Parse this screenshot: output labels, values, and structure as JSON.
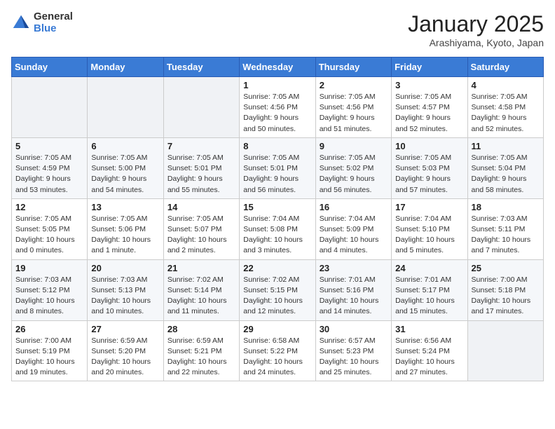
{
  "header": {
    "logo_general": "General",
    "logo_blue": "Blue",
    "title": "January 2025",
    "subtitle": "Arashiyama, Kyoto, Japan"
  },
  "weekdays": [
    "Sunday",
    "Monday",
    "Tuesday",
    "Wednesday",
    "Thursday",
    "Friday",
    "Saturday"
  ],
  "weeks": [
    [
      {
        "day": "",
        "empty": true
      },
      {
        "day": "",
        "empty": true
      },
      {
        "day": "",
        "empty": true
      },
      {
        "day": "1",
        "sunrise": "7:05 AM",
        "sunset": "4:56 PM",
        "daylight": "9 hours and 50 minutes."
      },
      {
        "day": "2",
        "sunrise": "7:05 AM",
        "sunset": "4:56 PM",
        "daylight": "9 hours and 51 minutes."
      },
      {
        "day": "3",
        "sunrise": "7:05 AM",
        "sunset": "4:57 PM",
        "daylight": "9 hours and 52 minutes."
      },
      {
        "day": "4",
        "sunrise": "7:05 AM",
        "sunset": "4:58 PM",
        "daylight": "9 hours and 52 minutes."
      }
    ],
    [
      {
        "day": "5",
        "sunrise": "7:05 AM",
        "sunset": "4:59 PM",
        "daylight": "9 hours and 53 minutes."
      },
      {
        "day": "6",
        "sunrise": "7:05 AM",
        "sunset": "5:00 PM",
        "daylight": "9 hours and 54 minutes."
      },
      {
        "day": "7",
        "sunrise": "7:05 AM",
        "sunset": "5:01 PM",
        "daylight": "9 hours and 55 minutes."
      },
      {
        "day": "8",
        "sunrise": "7:05 AM",
        "sunset": "5:01 PM",
        "daylight": "9 hours and 56 minutes."
      },
      {
        "day": "9",
        "sunrise": "7:05 AM",
        "sunset": "5:02 PM",
        "daylight": "9 hours and 56 minutes."
      },
      {
        "day": "10",
        "sunrise": "7:05 AM",
        "sunset": "5:03 PM",
        "daylight": "9 hours and 57 minutes."
      },
      {
        "day": "11",
        "sunrise": "7:05 AM",
        "sunset": "5:04 PM",
        "daylight": "9 hours and 58 minutes."
      }
    ],
    [
      {
        "day": "12",
        "sunrise": "7:05 AM",
        "sunset": "5:05 PM",
        "daylight": "10 hours and 0 minutes."
      },
      {
        "day": "13",
        "sunrise": "7:05 AM",
        "sunset": "5:06 PM",
        "daylight": "10 hours and 1 minute."
      },
      {
        "day": "14",
        "sunrise": "7:05 AM",
        "sunset": "5:07 PM",
        "daylight": "10 hours and 2 minutes."
      },
      {
        "day": "15",
        "sunrise": "7:04 AM",
        "sunset": "5:08 PM",
        "daylight": "10 hours and 3 minutes."
      },
      {
        "day": "16",
        "sunrise": "7:04 AM",
        "sunset": "5:09 PM",
        "daylight": "10 hours and 4 minutes."
      },
      {
        "day": "17",
        "sunrise": "7:04 AM",
        "sunset": "5:10 PM",
        "daylight": "10 hours and 5 minutes."
      },
      {
        "day": "18",
        "sunrise": "7:03 AM",
        "sunset": "5:11 PM",
        "daylight": "10 hours and 7 minutes."
      }
    ],
    [
      {
        "day": "19",
        "sunrise": "7:03 AM",
        "sunset": "5:12 PM",
        "daylight": "10 hours and 8 minutes."
      },
      {
        "day": "20",
        "sunrise": "7:03 AM",
        "sunset": "5:13 PM",
        "daylight": "10 hours and 10 minutes."
      },
      {
        "day": "21",
        "sunrise": "7:02 AM",
        "sunset": "5:14 PM",
        "daylight": "10 hours and 11 minutes."
      },
      {
        "day": "22",
        "sunrise": "7:02 AM",
        "sunset": "5:15 PM",
        "daylight": "10 hours and 12 minutes."
      },
      {
        "day": "23",
        "sunrise": "7:01 AM",
        "sunset": "5:16 PM",
        "daylight": "10 hours and 14 minutes."
      },
      {
        "day": "24",
        "sunrise": "7:01 AM",
        "sunset": "5:17 PM",
        "daylight": "10 hours and 15 minutes."
      },
      {
        "day": "25",
        "sunrise": "7:00 AM",
        "sunset": "5:18 PM",
        "daylight": "10 hours and 17 minutes."
      }
    ],
    [
      {
        "day": "26",
        "sunrise": "7:00 AM",
        "sunset": "5:19 PM",
        "daylight": "10 hours and 19 minutes."
      },
      {
        "day": "27",
        "sunrise": "6:59 AM",
        "sunset": "5:20 PM",
        "daylight": "10 hours and 20 minutes."
      },
      {
        "day": "28",
        "sunrise": "6:59 AM",
        "sunset": "5:21 PM",
        "daylight": "10 hours and 22 minutes."
      },
      {
        "day": "29",
        "sunrise": "6:58 AM",
        "sunset": "5:22 PM",
        "daylight": "10 hours and 24 minutes."
      },
      {
        "day": "30",
        "sunrise": "6:57 AM",
        "sunset": "5:23 PM",
        "daylight": "10 hours and 25 minutes."
      },
      {
        "day": "31",
        "sunrise": "6:56 AM",
        "sunset": "5:24 PM",
        "daylight": "10 hours and 27 minutes."
      },
      {
        "day": "",
        "empty": true
      }
    ]
  ]
}
